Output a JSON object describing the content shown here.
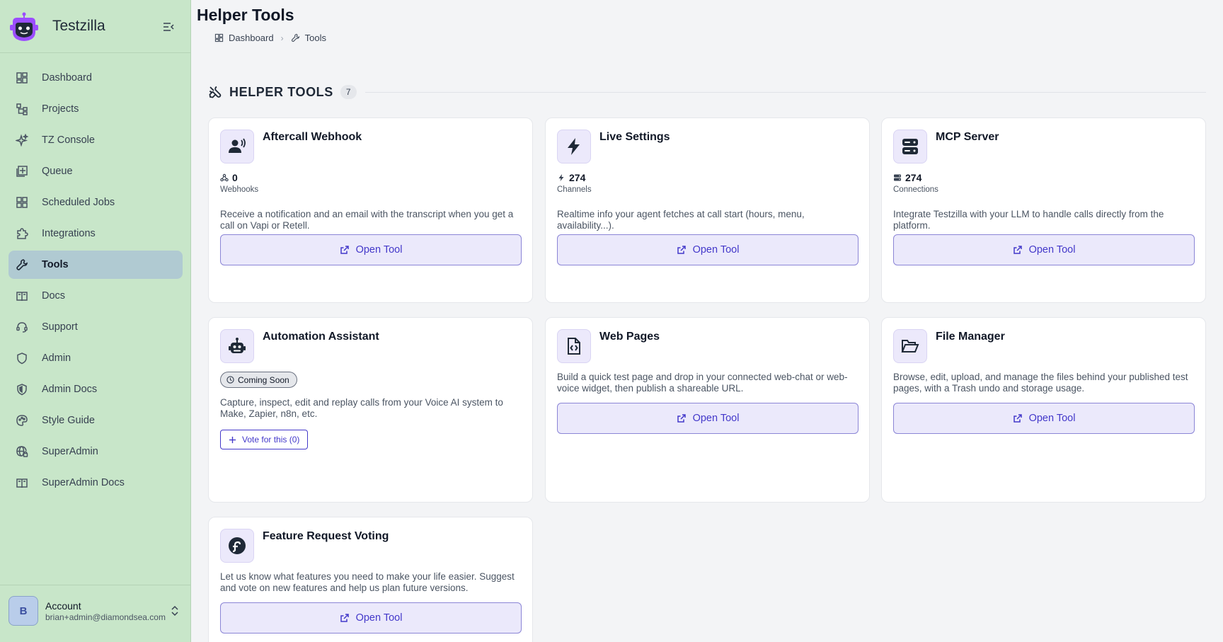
{
  "app": {
    "name": "Testzilla"
  },
  "sidebar": {
    "items": [
      {
        "label": "Dashboard",
        "icon": "dashboard-icon",
        "active": false
      },
      {
        "label": "Projects",
        "icon": "projects-icon",
        "active": false
      },
      {
        "label": "TZ Console",
        "icon": "sparkle-icon",
        "active": false
      },
      {
        "label": "Queue",
        "icon": "queue-icon",
        "active": false
      },
      {
        "label": "Scheduled Jobs",
        "icon": "grid-icon",
        "active": false
      },
      {
        "label": "Integrations",
        "icon": "puzzle-icon",
        "active": false
      },
      {
        "label": "Tools",
        "icon": "wrench-icon",
        "active": true
      },
      {
        "label": "Docs",
        "icon": "book-icon",
        "active": false
      },
      {
        "label": "Support",
        "icon": "headset-icon",
        "active": false
      },
      {
        "label": "Admin",
        "icon": "shield-icon",
        "active": false
      },
      {
        "label": "Admin Docs",
        "icon": "shield-doc-icon",
        "active": false
      },
      {
        "label": "Style Guide",
        "icon": "palette-icon",
        "active": false
      },
      {
        "label": "SuperAdmin",
        "icon": "globe-lock-icon",
        "active": false
      },
      {
        "label": "SuperAdmin Docs",
        "icon": "book-icon",
        "active": false
      }
    ],
    "account": {
      "initial": "B",
      "label": "Account",
      "email": "brian+admin@diamondsea.com"
    }
  },
  "header": {
    "title": "Helper Tools",
    "breadcrumb": [
      {
        "label": "Dashboard",
        "icon": "dashboard-icon"
      },
      {
        "label": "Tools",
        "icon": "wrench-icon"
      }
    ]
  },
  "section": {
    "title": "HELPER TOOLS",
    "count": "7"
  },
  "tools": [
    {
      "title": "Aftercall Webhook",
      "icon": "person-voice-icon",
      "stat_value": "0",
      "stat_label": "Webhooks",
      "stat_icon": "webhook-icon",
      "description": "Receive a notification and an email with the transcript when you get a call on Vapi or Retell.",
      "button": "Open Tool"
    },
    {
      "title": "Live Settings",
      "icon": "bolt-icon",
      "stat_value": "274",
      "stat_label": "Channels",
      "stat_icon": "bolt-icon",
      "description": "Realtime info your agent fetches at call start (hours, menu, availability...).",
      "button": "Open Tool"
    },
    {
      "title": "MCP Server",
      "icon": "server-icon",
      "stat_value": "274",
      "stat_label": "Connections",
      "stat_icon": "server-icon",
      "description": "Integrate Testzilla with your LLM to handle calls directly from the platform.",
      "button": "Open Tool"
    },
    {
      "title": "Automation Assistant",
      "icon": "robot-icon",
      "badge": "Coming Soon",
      "description": "Capture, inspect, edit and replay calls from your Voice AI system to Make, Zapier, n8n, etc.",
      "vote_button": "Vote for this (0)"
    },
    {
      "title": "Web Pages",
      "icon": "code-file-icon",
      "description": "Build a quick test page and drop in your connected web-chat or web-voice widget, then publish a shareable URL.",
      "button": "Open Tool"
    },
    {
      "title": "File Manager",
      "icon": "folder-open-icon",
      "description": "Browse, edit, upload, and manage the files behind your published test pages, with a Trash undo and storage usage.",
      "button": "Open Tool"
    },
    {
      "title": "Feature Request Voting",
      "icon": "fedora-icon",
      "description": "Let us know what features you need to make your life easier. Suggest and vote on new features and help us plan future versions.",
      "button": "Open Tool"
    }
  ],
  "colors": {
    "sidebar_bg": "#c8e6c9",
    "active_item": "#b0cad2",
    "accent": "#4338ca",
    "button_bg": "#ebe9fb",
    "logo": "#9b4dff"
  }
}
